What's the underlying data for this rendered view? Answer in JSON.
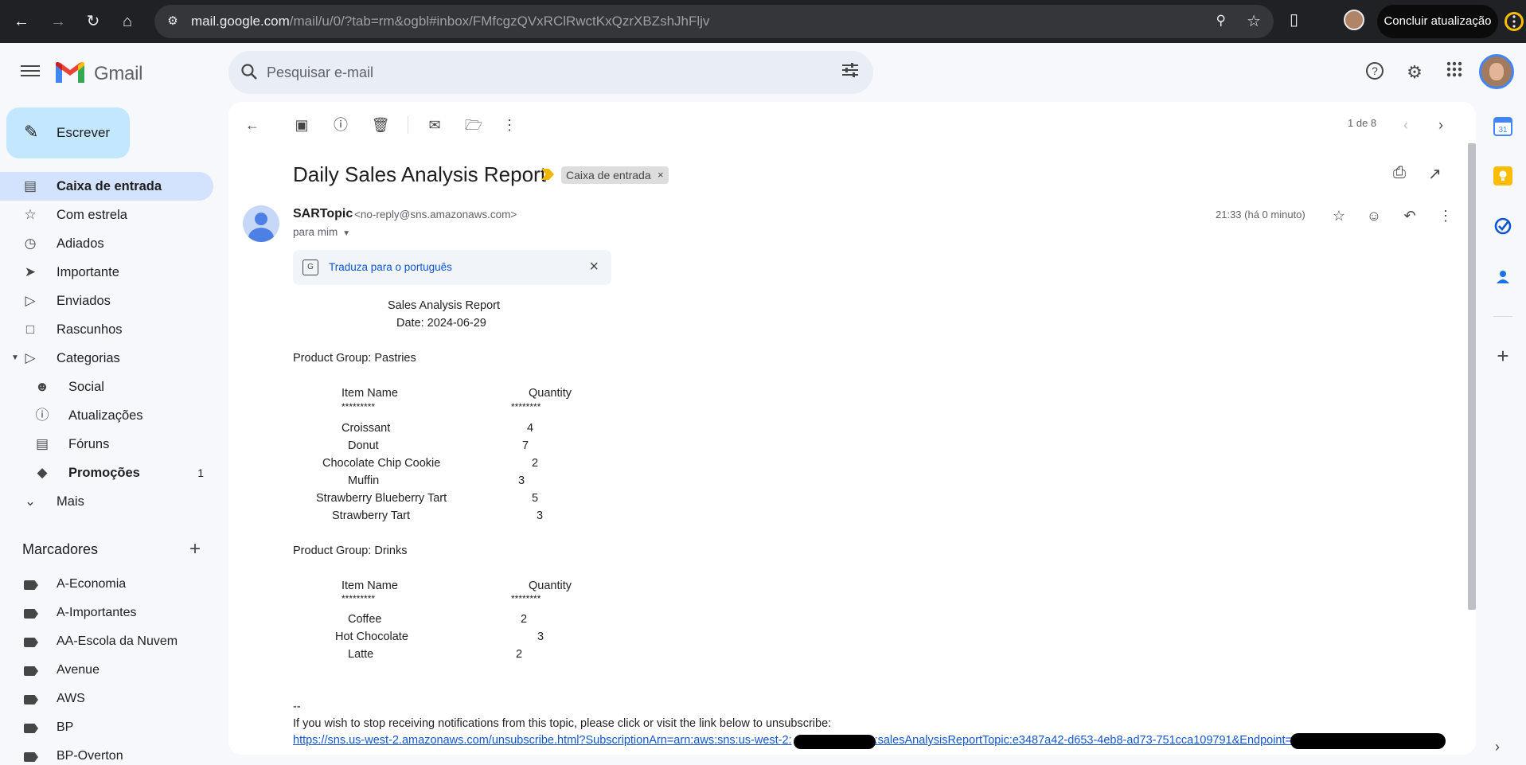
{
  "browser": {
    "url_host": "mail.google.com",
    "url_path": "/mail/u/0/?tab=rm&ogbl#inbox/FMfcgzQVxRClRwctKxQzrXBZshJhFljv",
    "update_button": "Concluir atualização"
  },
  "gmail": {
    "brand": "Gmail",
    "search_placeholder": "Pesquisar e-mail"
  },
  "sidebar": {
    "compose_label": "Escrever",
    "items": [
      {
        "label": "Caixa de entrada",
        "icon": "inbox-icon",
        "active": true
      },
      {
        "label": "Com estrela",
        "icon": "star-icon"
      },
      {
        "label": "Adiados",
        "icon": "clock-icon"
      },
      {
        "label": "Importante",
        "icon": "important-icon"
      },
      {
        "label": "Enviados",
        "icon": "send-icon"
      },
      {
        "label": "Rascunhos",
        "icon": "draft-icon"
      },
      {
        "label": "Categorias",
        "icon": "label-icon"
      },
      {
        "label": "Social",
        "icon": "people-icon"
      },
      {
        "label": "Atualizações",
        "icon": "info-icon"
      },
      {
        "label": "Fóruns",
        "icon": "forum-icon"
      },
      {
        "label": "Promoções",
        "icon": "tag-icon",
        "count": "1"
      },
      {
        "label": "Mais",
        "icon": "chevron-down-icon"
      }
    ],
    "labels_title": "Marcadores",
    "labels": [
      "A-Economia",
      "A-Importantes",
      "AA-Escola da Nuvem",
      "Avenue",
      "AWS",
      "BP",
      "BP-Overton"
    ]
  },
  "toolbar": {
    "pager": "1 de 8"
  },
  "message": {
    "subject": "Daily Sales Analysis Report",
    "label_chip": "Caixa de entrada",
    "sender_name": "SARTopic",
    "sender_email": "<no-reply@sns.amazonaws.com>",
    "to": "para mim",
    "time": "21:33 (há 0 minuto)",
    "translate": "Traduza para o português",
    "report_title": "Sales Analysis Report",
    "report_date": "Date: 2024-06-29",
    "groups": [
      {
        "heading": "Product Group: Pastries",
        "col_item": "Item Name",
        "col_qty": "Quantity",
        "sep_item": "*********",
        "sep_qty": "********",
        "rows": [
          {
            "name": "Croissant",
            "qty": "4"
          },
          {
            "name": "Donut",
            "qty": "7"
          },
          {
            "name": "Chocolate Chip Cookie",
            "qty": "2"
          },
          {
            "name": "Muffin",
            "qty": "3"
          },
          {
            "name": "Strawberry Blueberry Tart",
            "qty": "5"
          },
          {
            "name": "Strawberry Tart",
            "qty": "3"
          }
        ]
      },
      {
        "heading": "Product Group: Drinks",
        "col_item": "Item Name",
        "col_qty": "Quantity",
        "sep_item": "*********",
        "sep_qty": "********",
        "rows": [
          {
            "name": "Coffee",
            "qty": "2"
          },
          {
            "name": "Hot Chocolate",
            "qty": "3"
          },
          {
            "name": "Latte",
            "qty": "2"
          }
        ]
      }
    ],
    "sig_dashes": "--",
    "unsub_text": "If you wish to stop receiving notifications from this topic, please click or visit the link below to unsubscribe:",
    "unsub_link_a": "https://sns.us-west-2.amazonaws.com/unsubscribe.html?SubscriptionArn=arn:aws:sns:us-west-2:",
    "unsub_link_b": ":salesAnalysisReportTopic:e3487a42-d653-4eb8-ad73-751cca109791&Endpoint="
  }
}
